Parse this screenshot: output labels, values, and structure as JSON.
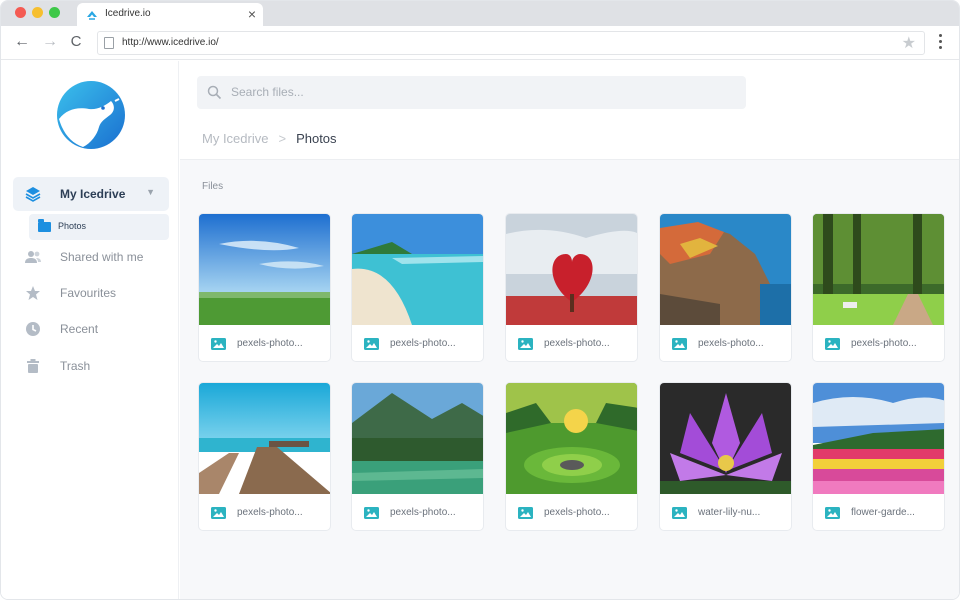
{
  "browser": {
    "tab_title": "Icedrive.io",
    "url": "http://www.icedrive.io/",
    "close_glyph": "×",
    "back_glyph": "←",
    "forward_glyph": "→",
    "reload_glyph": "C",
    "star_glyph": "★"
  },
  "sidebar": {
    "items": [
      {
        "label": "My Icedrive",
        "icon": "layers-icon"
      },
      {
        "label": "Shared with me",
        "icon": "users-icon"
      },
      {
        "label": "Favourites",
        "icon": "star-icon"
      },
      {
        "label": "Recent",
        "icon": "clock-icon"
      },
      {
        "label": "Trash",
        "icon": "trash-icon"
      }
    ],
    "subitem": {
      "label": "Photos",
      "icon": "folder-icon"
    },
    "chevron_glyph": "▼"
  },
  "search": {
    "placeholder": "Search files..."
  },
  "breadcrumb": {
    "root": "My Icedrive",
    "separator": ">",
    "current": "Photos"
  },
  "files_label": "Files",
  "files": [
    {
      "name": "pexels-photo..."
    },
    {
      "name": "pexels-photo..."
    },
    {
      "name": "pexels-photo..."
    },
    {
      "name": "pexels-photo..."
    },
    {
      "name": "pexels-photo..."
    },
    {
      "name": "pexels-photo..."
    },
    {
      "name": "pexels-photo..."
    },
    {
      "name": "pexels-photo..."
    },
    {
      "name": "water-lily-nu..."
    },
    {
      "name": "flower-garde..."
    }
  ],
  "colors": {
    "accent": "#1d8fe0",
    "image_icon": "#2bb3c0",
    "sidebar_active_bg": "#eef2f7"
  }
}
